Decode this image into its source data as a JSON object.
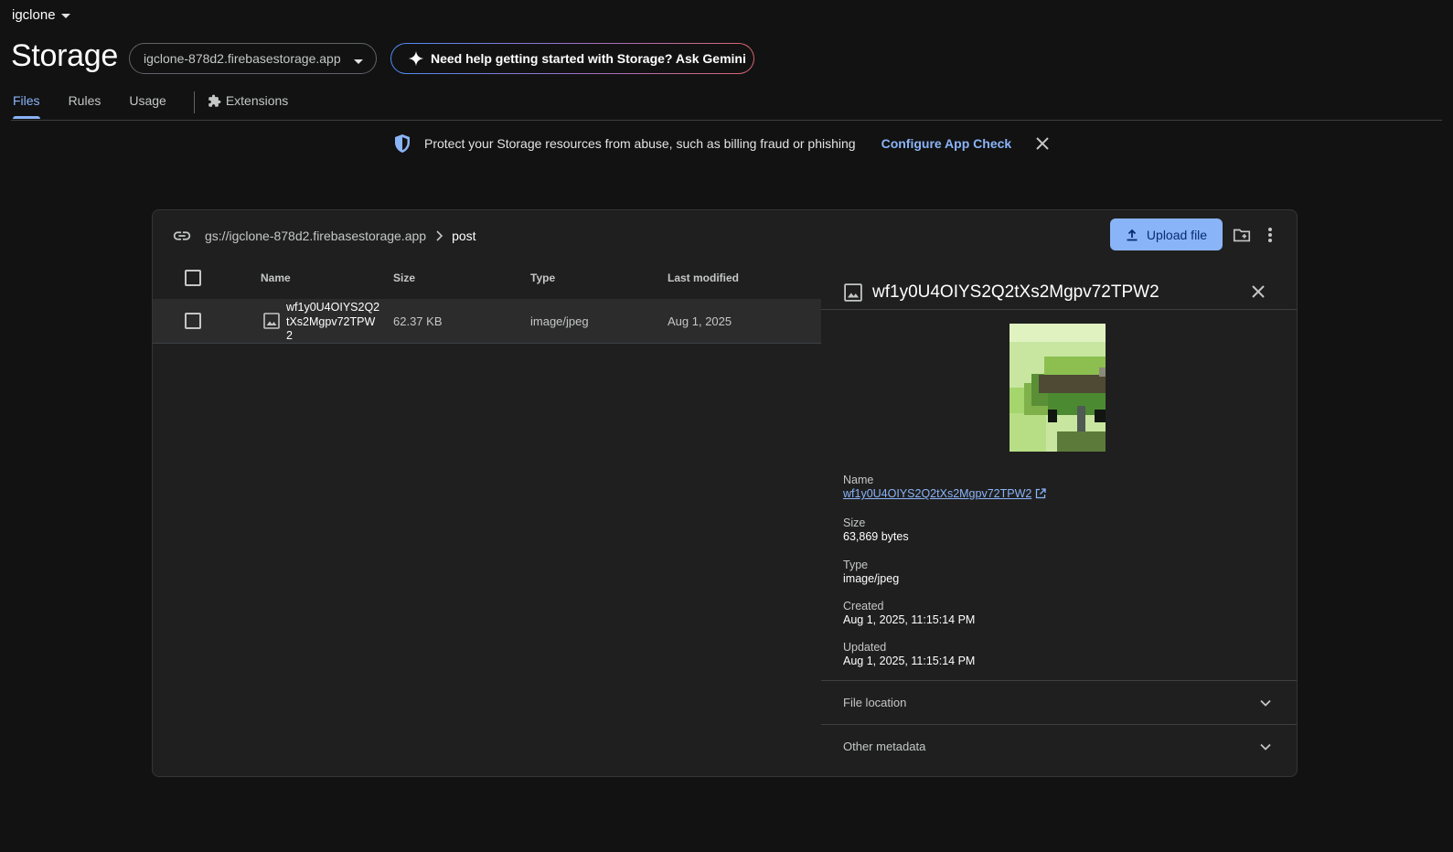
{
  "header": {
    "project_name": "igclone",
    "title": "Storage",
    "bucket_selector": "igclone-878d2.firebasestorage.app",
    "gemini_button": "Need help getting started with Storage? Ask Gemini"
  },
  "tabs": {
    "files": "Files",
    "rules": "Rules",
    "usage": "Usage",
    "extensions": "Extensions",
    "active": "Files"
  },
  "banner": {
    "message": "Protect your Storage resources from abuse, such as billing fraud or phishing",
    "link": "Configure App Check"
  },
  "browser": {
    "path_bucket": "gs://igclone-878d2.firebasestorage.app",
    "path_folder": "post",
    "upload_label": "Upload file",
    "columns": {
      "name": "Name",
      "size": "Size",
      "type": "Type",
      "modified": "Last modified"
    },
    "rows": [
      {
        "name_lines": [
          "wf1y0U4OIYS2Q2",
          "tXs2Mgpv72TPW",
          "2"
        ],
        "size": "62.37 KB",
        "type": "image/jpeg",
        "modified": "Aug 1, 2025"
      }
    ]
  },
  "details": {
    "title": "wf1y0U4OIYS2Q2tXs2Mgpv72TPW2",
    "name_label": "Name",
    "name_value": "wf1y0U4OIYS2Q2tXs2Mgpv72TPW2",
    "size_label": "Size",
    "size_value": "63,869 bytes",
    "type_label": "Type",
    "type_value": "image/jpeg",
    "created_label": "Created",
    "created_value": "Aug 1, 2025, 11:15:14 PM",
    "updated_label": "Updated",
    "updated_value": "Aug 1, 2025, 11:15:14 PM",
    "file_location": "File location",
    "other_metadata": "Other metadata"
  },
  "colors": {
    "background": "#121212",
    "panel": "#1f1f1f",
    "accent": "#8ab4f8"
  }
}
